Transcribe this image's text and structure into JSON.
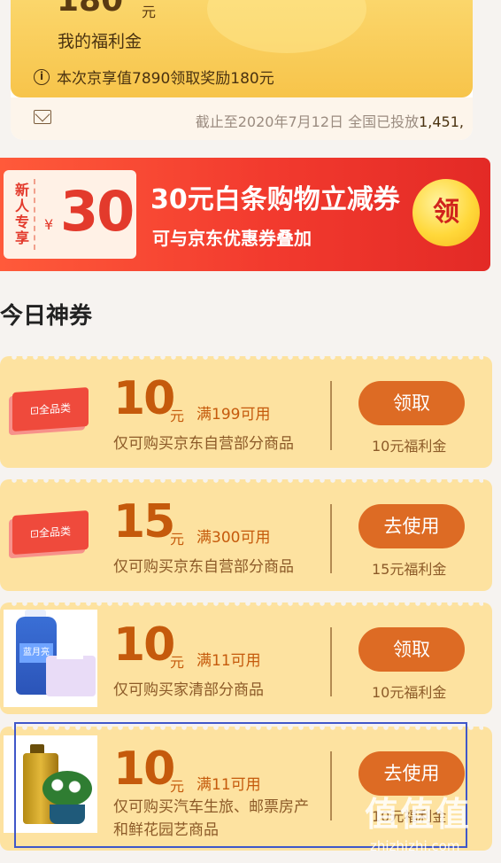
{
  "top_card": {
    "amount": "180",
    "amount_unit": "元",
    "label": "我的福利金",
    "info_text": "本次京享值7890领取奖励180元",
    "deadline_text": "截止至2020年7月12日 全国已投放",
    "deadline_count": "1,451,"
  },
  "banner": {
    "ticket_side": "新人专享",
    "ticket_yen": "¥",
    "ticket_amount": "30",
    "title": "30元白条购物立减券",
    "subtitle": "可与京东优惠券叠加",
    "button": "领"
  },
  "section": {
    "title": "今日神券"
  },
  "coupons": [
    {
      "tag": "全品类",
      "amount": "10",
      "unit": "元",
      "condition": "满199可用",
      "description": "仅可购买京东自营部分商品",
      "action": "领取",
      "reward": "10元福利金"
    },
    {
      "tag": "全品类",
      "amount": "15",
      "unit": "元",
      "condition": "满300可用",
      "description": "仅可购买京东自营部分商品",
      "action": "去使用",
      "reward": "15元福利金"
    },
    {
      "amount": "10",
      "unit": "元",
      "condition": "满11可用",
      "description": "仅可购买家清部分商品",
      "action": "领取",
      "reward": "10元福利金",
      "product_label": "蓝月亮"
    },
    {
      "amount": "10",
      "unit": "元",
      "condition": "满11可用",
      "description": "仅可购买汽车生旅、邮票房产和鲜花园艺商品",
      "action": "去使用",
      "reward": "10元福利金"
    }
  ],
  "watermark": {
    "text": "值值值",
    "sub": "zhizhizhi.com"
  },
  "colors": {
    "accent_orange": "#dd6b24",
    "banner_red": "#f23a2e",
    "coupon_bg": "#fde2a0"
  }
}
